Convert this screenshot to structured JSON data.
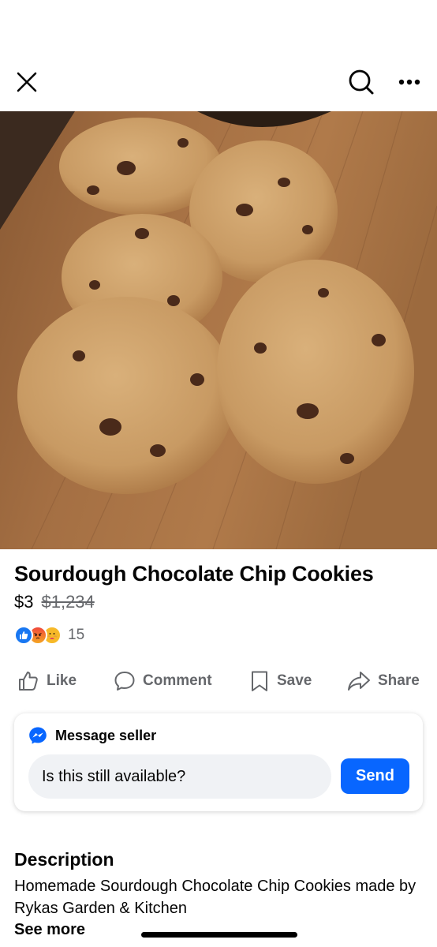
{
  "header": {
    "close_icon": "close-icon",
    "search_icon": "search-icon",
    "more_icon": "more-horizontal-icon"
  },
  "listing": {
    "image_subject": "chocolate chip cookies on wooden cutting board",
    "title": "Sourdough Chocolate Chip Cookies",
    "price": "$3",
    "original_price": "$1,234"
  },
  "reactions": {
    "types": [
      "like",
      "angry",
      "care"
    ],
    "count": "15"
  },
  "actions": {
    "like": "Like",
    "comment": "Comment",
    "save": "Save",
    "share": "Share"
  },
  "message": {
    "heading": "Message seller",
    "input_value": "Is this still available?",
    "send_label": "Send"
  },
  "description": {
    "heading": "Description",
    "text": "Homemade Sourdough Chocolate Chip Cookies made by Rykas Garden & Kitchen",
    "see_more": "See more"
  },
  "colors": {
    "accent": "#0866ff",
    "secondary_text": "#65676b",
    "input_bg": "#f0f2f5"
  }
}
